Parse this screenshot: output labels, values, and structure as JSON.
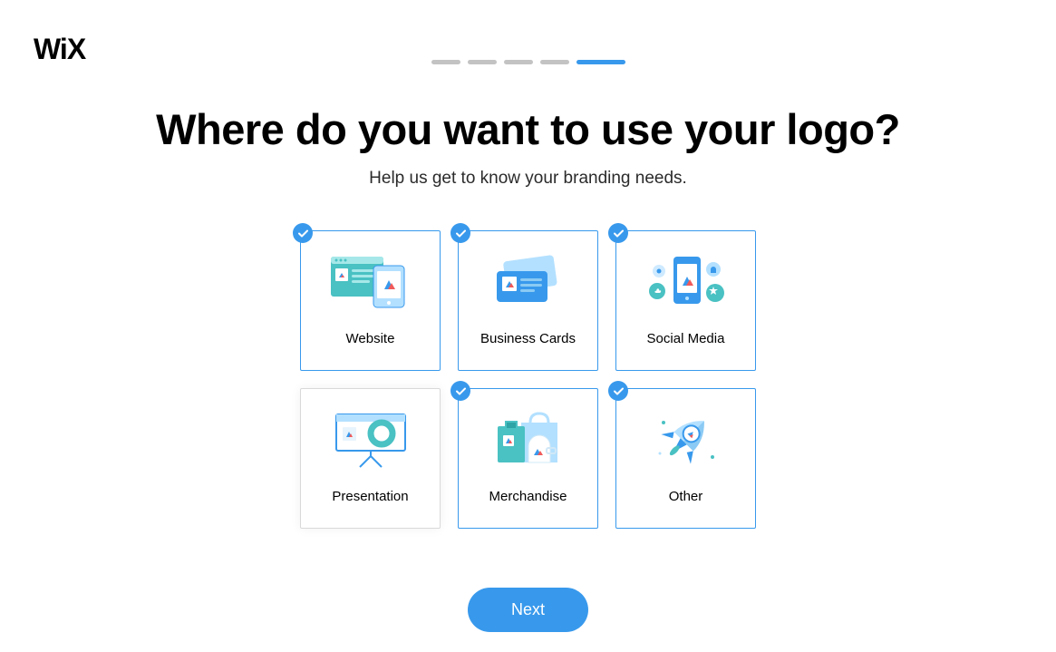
{
  "brand": "WiX",
  "progress": {
    "steps": 5,
    "current": 5
  },
  "heading": "Where do you want to use your logo?",
  "subheading": "Help us get to know your branding needs.",
  "options": [
    {
      "label": "Website",
      "selected": true,
      "icon": "website-icon"
    },
    {
      "label": "Business Cards",
      "selected": true,
      "icon": "business-cards-icon"
    },
    {
      "label": "Social Media",
      "selected": true,
      "icon": "social-media-icon"
    },
    {
      "label": "Presentation",
      "selected": false,
      "icon": "presentation-icon"
    },
    {
      "label": "Merchandise",
      "selected": true,
      "icon": "merchandise-icon"
    },
    {
      "label": "Other",
      "selected": true,
      "icon": "rocket-icon"
    }
  ],
  "next_label": "Next",
  "colors": {
    "accent": "#3899ec",
    "teal": "#4ac1c3",
    "light": "#b3e0ff"
  }
}
